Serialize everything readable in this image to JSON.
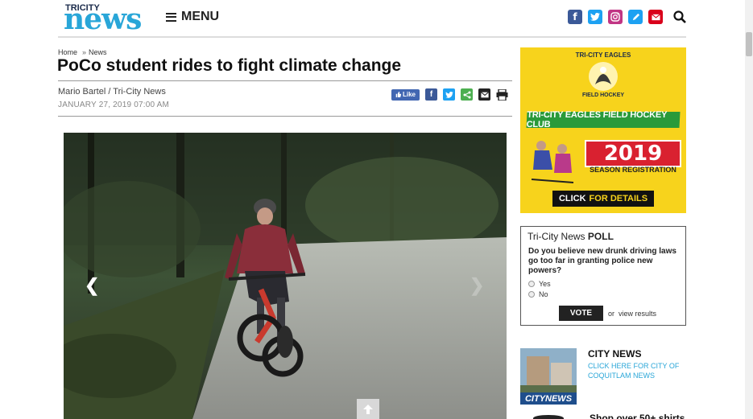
{
  "header": {
    "logo_top": "TRICITY",
    "logo_main": "news",
    "menu_label": "MENU",
    "social_icons": [
      "facebook-icon",
      "twitter-icon",
      "instagram-icon",
      "edit-icon",
      "email-icon"
    ],
    "colors": {
      "brand": "#29a6d8",
      "facebook": "#3b5998",
      "twitter": "#1da1f2",
      "instagram": "#c13584",
      "edit": "#1da1f2",
      "email": "#d9001b"
    }
  },
  "breadcrumb": {
    "home": "Home",
    "section": "News"
  },
  "article": {
    "title": "PoCo student rides to fight climate change",
    "byline": "Mario Bartel / Tri-City News",
    "date": "JANUARY 27, 2019 07:00 AM",
    "like_label": "Like"
  },
  "ad": {
    "top_label": "TRI-CITY EAGLES",
    "sub_label": "FIELD HOCKEY",
    "club": "TRI-CITY EAGLES FIELD HOCKEY CLUB",
    "year": "2019",
    "season": "SEASON REGISTRATION",
    "click_a": "CLICK",
    "click_b": "FOR DETAILS"
  },
  "poll": {
    "heading_a": "Tri-City News",
    "heading_b": "POLL",
    "question": "Do you believe new drunk driving laws go too far in granting police new powers?",
    "options": [
      "Yes",
      "No"
    ],
    "vote_label": "VOTE",
    "or_label": "or",
    "results_label": "view results"
  },
  "city": {
    "image_label": "CITYNEWS",
    "title": "CITY NEWS",
    "link": "CLICK HERE FOR CITY OF COQUITLAM NEWS"
  },
  "shop_text": "Shop over 50+ shirts"
}
